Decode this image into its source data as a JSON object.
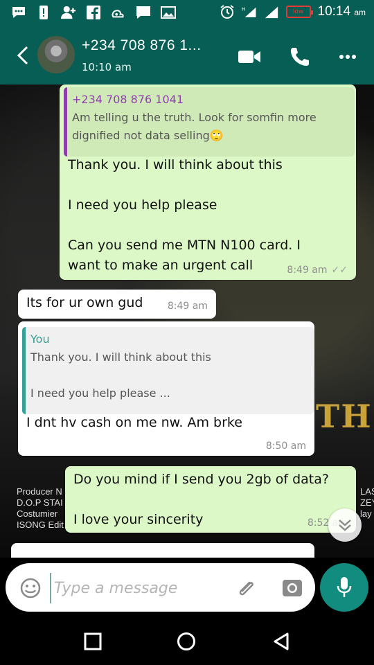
{
  "status_bar": {
    "time": "10:14",
    "ampm": "am",
    "battery_label": "low"
  },
  "header": {
    "contact": "+234 708 876 1...",
    "last_seen": "10:10 am"
  },
  "messages": [
    {
      "direction": "out",
      "quote_author": "+234 708 876 1041",
      "quote_text": "Am telling u the truth. Look for somfin more dignified not data selling🙄",
      "text": "Thank you. I will think about this\n\nI need you help please\n\nCan you send me MTN N100 card. I want to make an urgent call",
      "time": "8:49 am",
      "ticks": "✓✓"
    },
    {
      "direction": "in",
      "text": "Its for ur own gud",
      "time": "8:49 am"
    },
    {
      "direction": "in",
      "quote_author": "You",
      "quote_text": "Thank you. I will think about this\n\nI need you help please ...",
      "text": "I dnt hv cash on me nw. Am brke",
      "time": "8:50 am"
    },
    {
      "direction": "out",
      "text": "Do you mind if I send you 2gb of data?\n\nI love your sincerity",
      "time": "8:52 am"
    }
  ],
  "background": {
    "poster_word": "TH",
    "credits_left": [
      "Producer N",
      "D.O.P STAI",
      "Costumier",
      "ISONG Edit"
    ],
    "credits_right": [
      "LASH",
      "ZEY",
      "lay"
    ]
  },
  "input": {
    "placeholder": "Type a message"
  },
  "colors": {
    "header": "#075e54",
    "outgoing_bubble": "#dcf8c6",
    "incoming_bubble": "#ffffff",
    "mic_button": "#128c7e"
  }
}
